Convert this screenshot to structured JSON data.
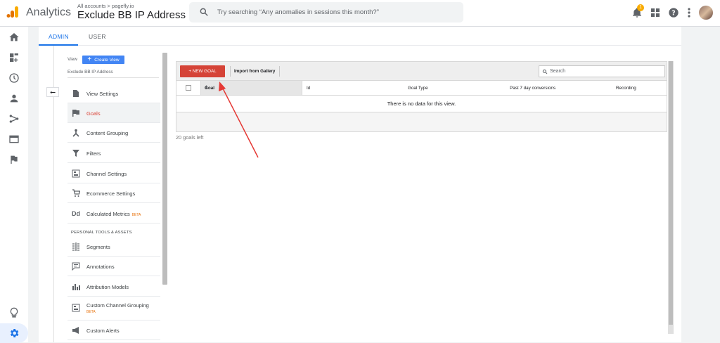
{
  "topbar": {
    "app_name": "Analytics",
    "breadcrumb": "All accounts > pagefly.io",
    "view_title": "Exclude BB IP Address",
    "search_placeholder": "Try searching “Any anomalies in sessions this month?”",
    "notification_count": "1"
  },
  "tabs": {
    "admin": "ADMIN",
    "user": "USER"
  },
  "view_panel": {
    "label": "View",
    "create_view": "Create View",
    "view_name": "Exclude BB IP Address"
  },
  "menu": {
    "items": [
      {
        "label": "View Settings",
        "icon": "document-icon"
      },
      {
        "label": "Goals",
        "icon": "flag-icon",
        "selected": true
      },
      {
        "label": "Content Grouping",
        "icon": "grouping-icon"
      },
      {
        "label": "Filters",
        "icon": "filter-icon"
      },
      {
        "label": "Channel Settings",
        "icon": "channel-icon"
      },
      {
        "label": "Ecommerce Settings",
        "icon": "cart-icon"
      },
      {
        "label": "Calculated Metrics",
        "icon": "dd-icon",
        "badge": "BETA"
      }
    ],
    "section_header": "PERSONAL TOOLS & ASSETS",
    "personal_items": [
      {
        "label": "Segments",
        "icon": "segments-icon"
      },
      {
        "label": "Annotations",
        "icon": "annotation-icon"
      },
      {
        "label": "Attribution Models",
        "icon": "bar-chart-icon"
      },
      {
        "label": "Custom Channel Grouping",
        "icon": "channel-icon",
        "badge": "BETA"
      },
      {
        "label": "Custom Alerts",
        "icon": "megaphone-icon"
      }
    ]
  },
  "goals_table": {
    "new_goal": "+ NEW GOAL",
    "import": "Import from Gallery",
    "search_placeholder": "Search",
    "columns": [
      "Goal",
      "Id",
      "Goal Type",
      "Past 7 day conversions",
      "Recording"
    ],
    "empty_message": "There is no data for this view.",
    "goals_left": "20 goals left"
  },
  "colors": {
    "accent_blue": "#1a73e8",
    "new_goal_red": "#d54337",
    "selected_red": "#db4437",
    "annotation_arrow": "#e53935"
  }
}
